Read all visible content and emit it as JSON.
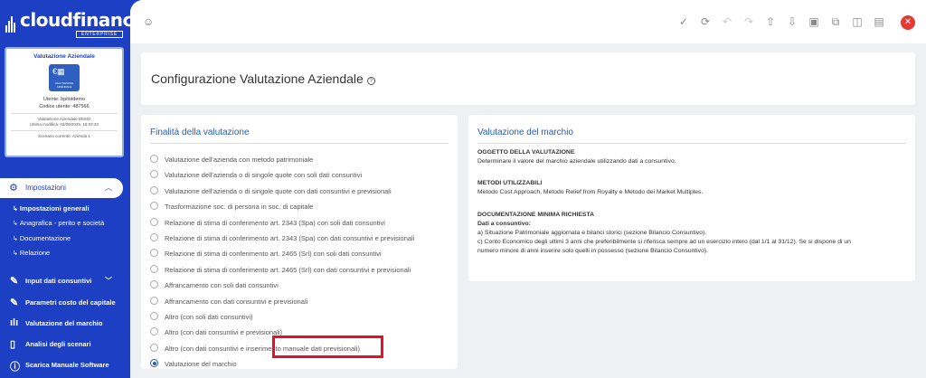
{
  "brand": {
    "name": "cloudfinance",
    "edition": "ENTERPRISE"
  },
  "company_card": {
    "title": "Valutazione Aziendale",
    "logo_text": "VALUTAZIONE AZIENDALE",
    "user_line": "Utente: bpilotdemo",
    "code_line": "Codice utente: 487566",
    "demo_line": "Valutazione Aziendale DEMO",
    "modified_line": "Ultima modifica: 02/09/2025, 16:03:33",
    "scenario_line": "Scenario corrente: Azienda 1"
  },
  "sidebar": {
    "section_label": "Impostazioni",
    "sub_items": [
      {
        "label": "Impostazioni generali",
        "active": true
      },
      {
        "label": "Anagrafica - perito e società",
        "active": false
      },
      {
        "label": "Documentazione",
        "active": false
      },
      {
        "label": "Relazione",
        "active": false
      }
    ],
    "nav_items": [
      {
        "label": "Input dati consuntivi",
        "icon": "edit-icon"
      },
      {
        "label": "Parametri costo del capitale",
        "icon": "edit-icon"
      },
      {
        "label": "Valutazione del marchio",
        "icon": "bar-chart-icon"
      },
      {
        "label": "Analisi degli scenari",
        "icon": "columns-icon"
      },
      {
        "label": "Scarica Manuale Software",
        "icon": "help-circle-icon"
      }
    ]
  },
  "page": {
    "title": "Configurazione Valutazione Aziendale"
  },
  "finalita": {
    "title": "Finalità della valutazione",
    "options": [
      "Valutazione dell'azienda con metodo patrimoniale",
      "Valutazione dell'azienda o di singole quote con soli dati consuntivi",
      "Valutazione dell'azienda o di singole quote con dati consuntivi e previsionali",
      "Trasformazione soc. di persona in soc. di capitale",
      "Relazione di stima di conferimento art. 2343 (Spa) con soli dati consuntivi",
      "Relazione di stima di conferimento art. 2343 (Spa) con dati consuntivi e previsionali",
      "Relazione di stima di conferimento art. 2465 (Srl) con soli dati consuntivi",
      "Relazione di stima di conferimento art. 2465 (Srl) con dati consuntivi e previsionali",
      "Affrancamento con soli dati consuntivi",
      "Affrancamento con dati consuntivi e previsionali",
      "Altro (con soli dati consuntivi)",
      "Altro (con dati consuntivi e previsionali)",
      "Altro (con dati consuntivi e inserimento manuale dati previsionali)",
      "Valutazione del marchio"
    ],
    "selected_index": 13
  },
  "marchio": {
    "title": "Valutazione del marchio",
    "oggetto_head": "OGGETTO DELLA VALUTAZIONE",
    "oggetto_text": "Determinare il valore del marchio aziendale utilizzando dati a consuntivo.",
    "metodi_head": "METODI UTILIZZABILI",
    "metodi_text": "Metodo Cost Approach, Metodo Relief from Royalty e Metodo dei Market Multiples.",
    "doc_head": "DOCUMENTAZIONE MINIMA RICHIESTA",
    "doc_sub": "Dati a consuntivo:",
    "doc_a": "a) Situazione Patrimoniale aggiornata e bilanci storici (sezione Bilancio Consuntivo).",
    "doc_c1": "c) Conto Economico degli ultimi 3 anni che preferibilmente si riferisca sempre ad un esercizio intero (dal 1/1 al 31/12). Se si dispone di un",
    "doc_c2": "numero minore di anni inserire solo quelli in possesso (sezione Bilancio Consuntivo)."
  },
  "colors": {
    "brand_blue": "#1d3fc4",
    "accent_blue": "#2a5db0",
    "highlight_red": "#e3102b",
    "close_red": "#e53935"
  }
}
